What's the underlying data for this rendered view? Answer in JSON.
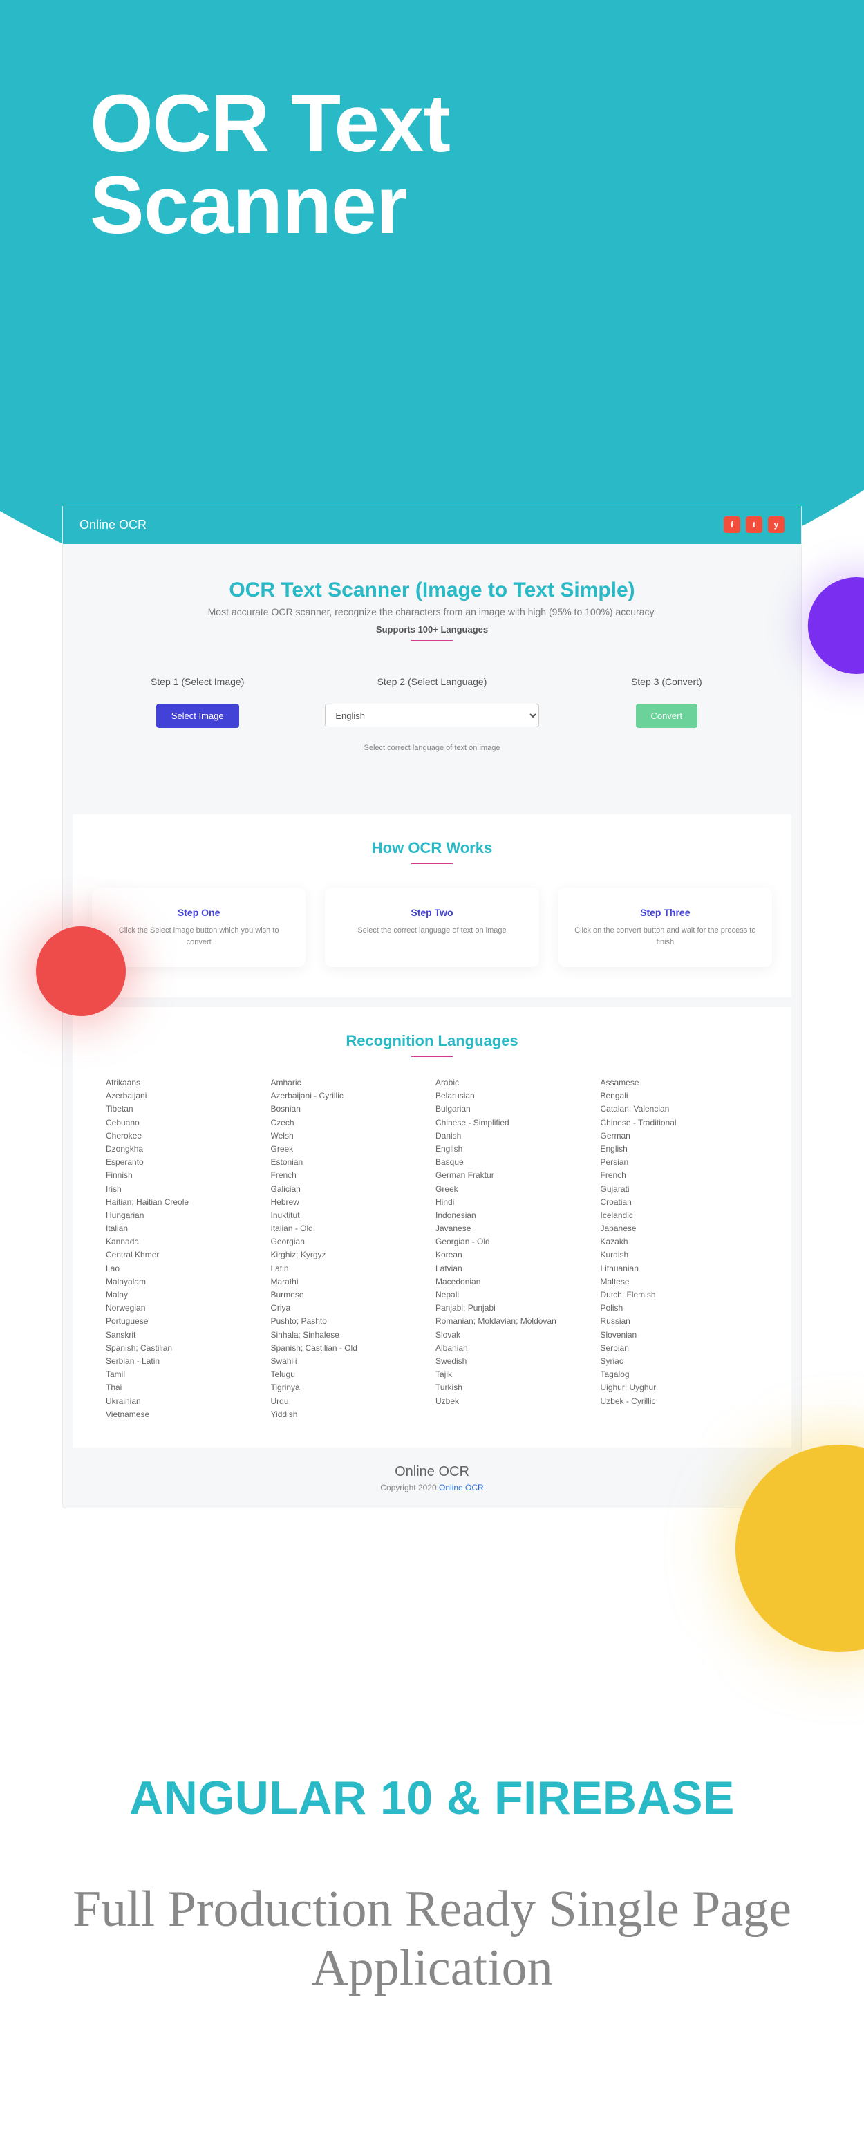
{
  "hero": {
    "title": "OCR Text\nScanner"
  },
  "topbar": {
    "brand": "Online OCR",
    "social": [
      "f",
      "t",
      "y"
    ]
  },
  "intro": {
    "title": "OCR Text Scanner (Image to Text Simple)",
    "subtitle": "Most accurate OCR scanner, recognize the characters from an image with high (95% to 100%) accuracy.",
    "supports": "Supports 100+ Languages"
  },
  "steps": {
    "col1": {
      "label": "Step 1 (Select Image)",
      "button": "Select Image"
    },
    "col2": {
      "label": "Step 2 (Select Language)",
      "selected": "English",
      "helper": "Select correct language of text on image"
    },
    "col3": {
      "label": "Step 3 (Convert)",
      "button": "Convert"
    }
  },
  "how": {
    "title": "How OCR Works",
    "cards": [
      {
        "title": "Step One",
        "text": "Click the Select image button which you wish to convert"
      },
      {
        "title": "Step Two",
        "text": "Select the correct language of text on image"
      },
      {
        "title": "Step Three",
        "text": "Click on the convert button and wait for the process to finish"
      }
    ]
  },
  "languages": {
    "title": "Recognition Languages",
    "col1": [
      "Afrikaans",
      "Azerbaijani",
      "Tibetan",
      "Cebuano",
      "Cherokee",
      "Dzongkha",
      "Esperanto",
      "Finnish",
      "Irish",
      "Haitian; Haitian Creole",
      "Hungarian",
      "Italian",
      "Kannada",
      "Central Khmer",
      "Lao",
      "Malayalam",
      "Malay",
      "Norwegian",
      "Portuguese",
      "Sanskrit",
      "Spanish; Castilian",
      "Serbian - Latin",
      "Tamil",
      "Thai",
      "Ukrainian",
      "Vietnamese"
    ],
    "col2": [
      "Amharic",
      "Azerbaijani - Cyrillic",
      "Bosnian",
      "Czech",
      "Welsh",
      "Greek",
      "Estonian",
      "French",
      "Galician",
      "Hebrew",
      "Inuktitut",
      "Italian - Old",
      "Georgian",
      "Kirghiz; Kyrgyz",
      "Latin",
      "Marathi",
      "Burmese",
      "Oriya",
      "Pushto; Pashto",
      "Sinhala; Sinhalese",
      "Spanish; Castilian - Old",
      "Swahili",
      "Telugu",
      "Tigrinya",
      "Urdu",
      "Yiddish"
    ],
    "col3": [
      "Arabic",
      "Belarusian",
      "Bulgarian",
      "Chinese - Simplified",
      "Danish",
      "English",
      "Basque",
      "German Fraktur",
      "Greek",
      "Hindi",
      "Indonesian",
      "Javanese",
      "Georgian - Old",
      "Korean",
      "Latvian",
      "Macedonian",
      "Nepali",
      "Panjabi; Punjabi",
      "Romanian; Moldavian; Moldovan",
      "Slovak",
      "Albanian",
      "Swedish",
      "Tajik",
      "Turkish",
      "Uzbek"
    ],
    "col4": [
      "Assamese",
      "Bengali",
      "Catalan; Valencian",
      "Chinese - Traditional",
      "German",
      "English",
      "Persian",
      "French",
      "Gujarati",
      "Croatian",
      "Icelandic",
      "Japanese",
      "Kazakh",
      "Kurdish",
      "Lithuanian",
      "Maltese",
      "Dutch; Flemish",
      "Polish",
      "Russian",
      "Slovenian",
      "Serbian",
      "Syriac",
      "Tagalog",
      "Uighur; Uyghur",
      "Uzbek - Cyrillic"
    ]
  },
  "footer": {
    "brand": "Online OCR",
    "copy_prefix": "Copyright 2020 ",
    "copy_link": "Online OCR"
  },
  "marketing": {
    "line1": "ANGULAR 10 & FIREBASE",
    "line2": "Full Production Ready Single Page Application"
  }
}
